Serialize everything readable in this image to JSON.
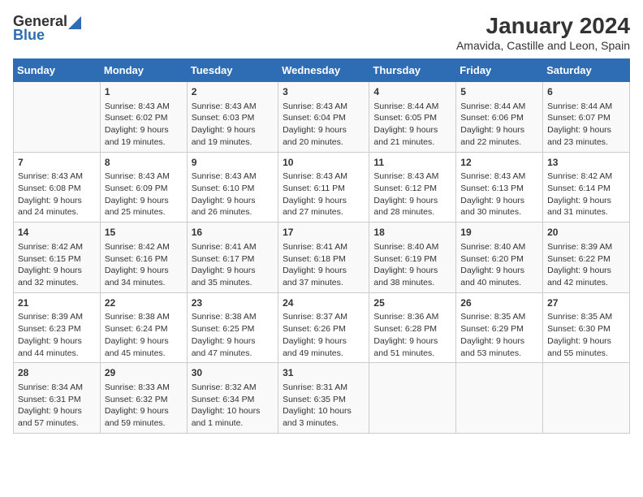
{
  "logo": {
    "general": "General",
    "blue": "Blue"
  },
  "title": "January 2024",
  "subtitle": "Amavida, Castille and Leon, Spain",
  "days_header": [
    "Sunday",
    "Monday",
    "Tuesday",
    "Wednesday",
    "Thursday",
    "Friday",
    "Saturday"
  ],
  "weeks": [
    [
      {
        "day": "",
        "content": ""
      },
      {
        "day": "1",
        "content": "Sunrise: 8:43 AM\nSunset: 6:02 PM\nDaylight: 9 hours\nand 19 minutes."
      },
      {
        "day": "2",
        "content": "Sunrise: 8:43 AM\nSunset: 6:03 PM\nDaylight: 9 hours\nand 19 minutes."
      },
      {
        "day": "3",
        "content": "Sunrise: 8:43 AM\nSunset: 6:04 PM\nDaylight: 9 hours\nand 20 minutes."
      },
      {
        "day": "4",
        "content": "Sunrise: 8:44 AM\nSunset: 6:05 PM\nDaylight: 9 hours\nand 21 minutes."
      },
      {
        "day": "5",
        "content": "Sunrise: 8:44 AM\nSunset: 6:06 PM\nDaylight: 9 hours\nand 22 minutes."
      },
      {
        "day": "6",
        "content": "Sunrise: 8:44 AM\nSunset: 6:07 PM\nDaylight: 9 hours\nand 23 minutes."
      }
    ],
    [
      {
        "day": "7",
        "content": "Sunrise: 8:43 AM\nSunset: 6:08 PM\nDaylight: 9 hours\nand 24 minutes."
      },
      {
        "day": "8",
        "content": "Sunrise: 8:43 AM\nSunset: 6:09 PM\nDaylight: 9 hours\nand 25 minutes."
      },
      {
        "day": "9",
        "content": "Sunrise: 8:43 AM\nSunset: 6:10 PM\nDaylight: 9 hours\nand 26 minutes."
      },
      {
        "day": "10",
        "content": "Sunrise: 8:43 AM\nSunset: 6:11 PM\nDaylight: 9 hours\nand 27 minutes."
      },
      {
        "day": "11",
        "content": "Sunrise: 8:43 AM\nSunset: 6:12 PM\nDaylight: 9 hours\nand 28 minutes."
      },
      {
        "day": "12",
        "content": "Sunrise: 8:43 AM\nSunset: 6:13 PM\nDaylight: 9 hours\nand 30 minutes."
      },
      {
        "day": "13",
        "content": "Sunrise: 8:42 AM\nSunset: 6:14 PM\nDaylight: 9 hours\nand 31 minutes."
      }
    ],
    [
      {
        "day": "14",
        "content": "Sunrise: 8:42 AM\nSunset: 6:15 PM\nDaylight: 9 hours\nand 32 minutes."
      },
      {
        "day": "15",
        "content": "Sunrise: 8:42 AM\nSunset: 6:16 PM\nDaylight: 9 hours\nand 34 minutes."
      },
      {
        "day": "16",
        "content": "Sunrise: 8:41 AM\nSunset: 6:17 PM\nDaylight: 9 hours\nand 35 minutes."
      },
      {
        "day": "17",
        "content": "Sunrise: 8:41 AM\nSunset: 6:18 PM\nDaylight: 9 hours\nand 37 minutes."
      },
      {
        "day": "18",
        "content": "Sunrise: 8:40 AM\nSunset: 6:19 PM\nDaylight: 9 hours\nand 38 minutes."
      },
      {
        "day": "19",
        "content": "Sunrise: 8:40 AM\nSunset: 6:20 PM\nDaylight: 9 hours\nand 40 minutes."
      },
      {
        "day": "20",
        "content": "Sunrise: 8:39 AM\nSunset: 6:22 PM\nDaylight: 9 hours\nand 42 minutes."
      }
    ],
    [
      {
        "day": "21",
        "content": "Sunrise: 8:39 AM\nSunset: 6:23 PM\nDaylight: 9 hours\nand 44 minutes."
      },
      {
        "day": "22",
        "content": "Sunrise: 8:38 AM\nSunset: 6:24 PM\nDaylight: 9 hours\nand 45 minutes."
      },
      {
        "day": "23",
        "content": "Sunrise: 8:38 AM\nSunset: 6:25 PM\nDaylight: 9 hours\nand 47 minutes."
      },
      {
        "day": "24",
        "content": "Sunrise: 8:37 AM\nSunset: 6:26 PM\nDaylight: 9 hours\nand 49 minutes."
      },
      {
        "day": "25",
        "content": "Sunrise: 8:36 AM\nSunset: 6:28 PM\nDaylight: 9 hours\nand 51 minutes."
      },
      {
        "day": "26",
        "content": "Sunrise: 8:35 AM\nSunset: 6:29 PM\nDaylight: 9 hours\nand 53 minutes."
      },
      {
        "day": "27",
        "content": "Sunrise: 8:35 AM\nSunset: 6:30 PM\nDaylight: 9 hours\nand 55 minutes."
      }
    ],
    [
      {
        "day": "28",
        "content": "Sunrise: 8:34 AM\nSunset: 6:31 PM\nDaylight: 9 hours\nand 57 minutes."
      },
      {
        "day": "29",
        "content": "Sunrise: 8:33 AM\nSunset: 6:32 PM\nDaylight: 9 hours\nand 59 minutes."
      },
      {
        "day": "30",
        "content": "Sunrise: 8:32 AM\nSunset: 6:34 PM\nDaylight: 10 hours\nand 1 minute."
      },
      {
        "day": "31",
        "content": "Sunrise: 8:31 AM\nSunset: 6:35 PM\nDaylight: 10 hours\nand 3 minutes."
      },
      {
        "day": "",
        "content": ""
      },
      {
        "day": "",
        "content": ""
      },
      {
        "day": "",
        "content": ""
      }
    ]
  ]
}
